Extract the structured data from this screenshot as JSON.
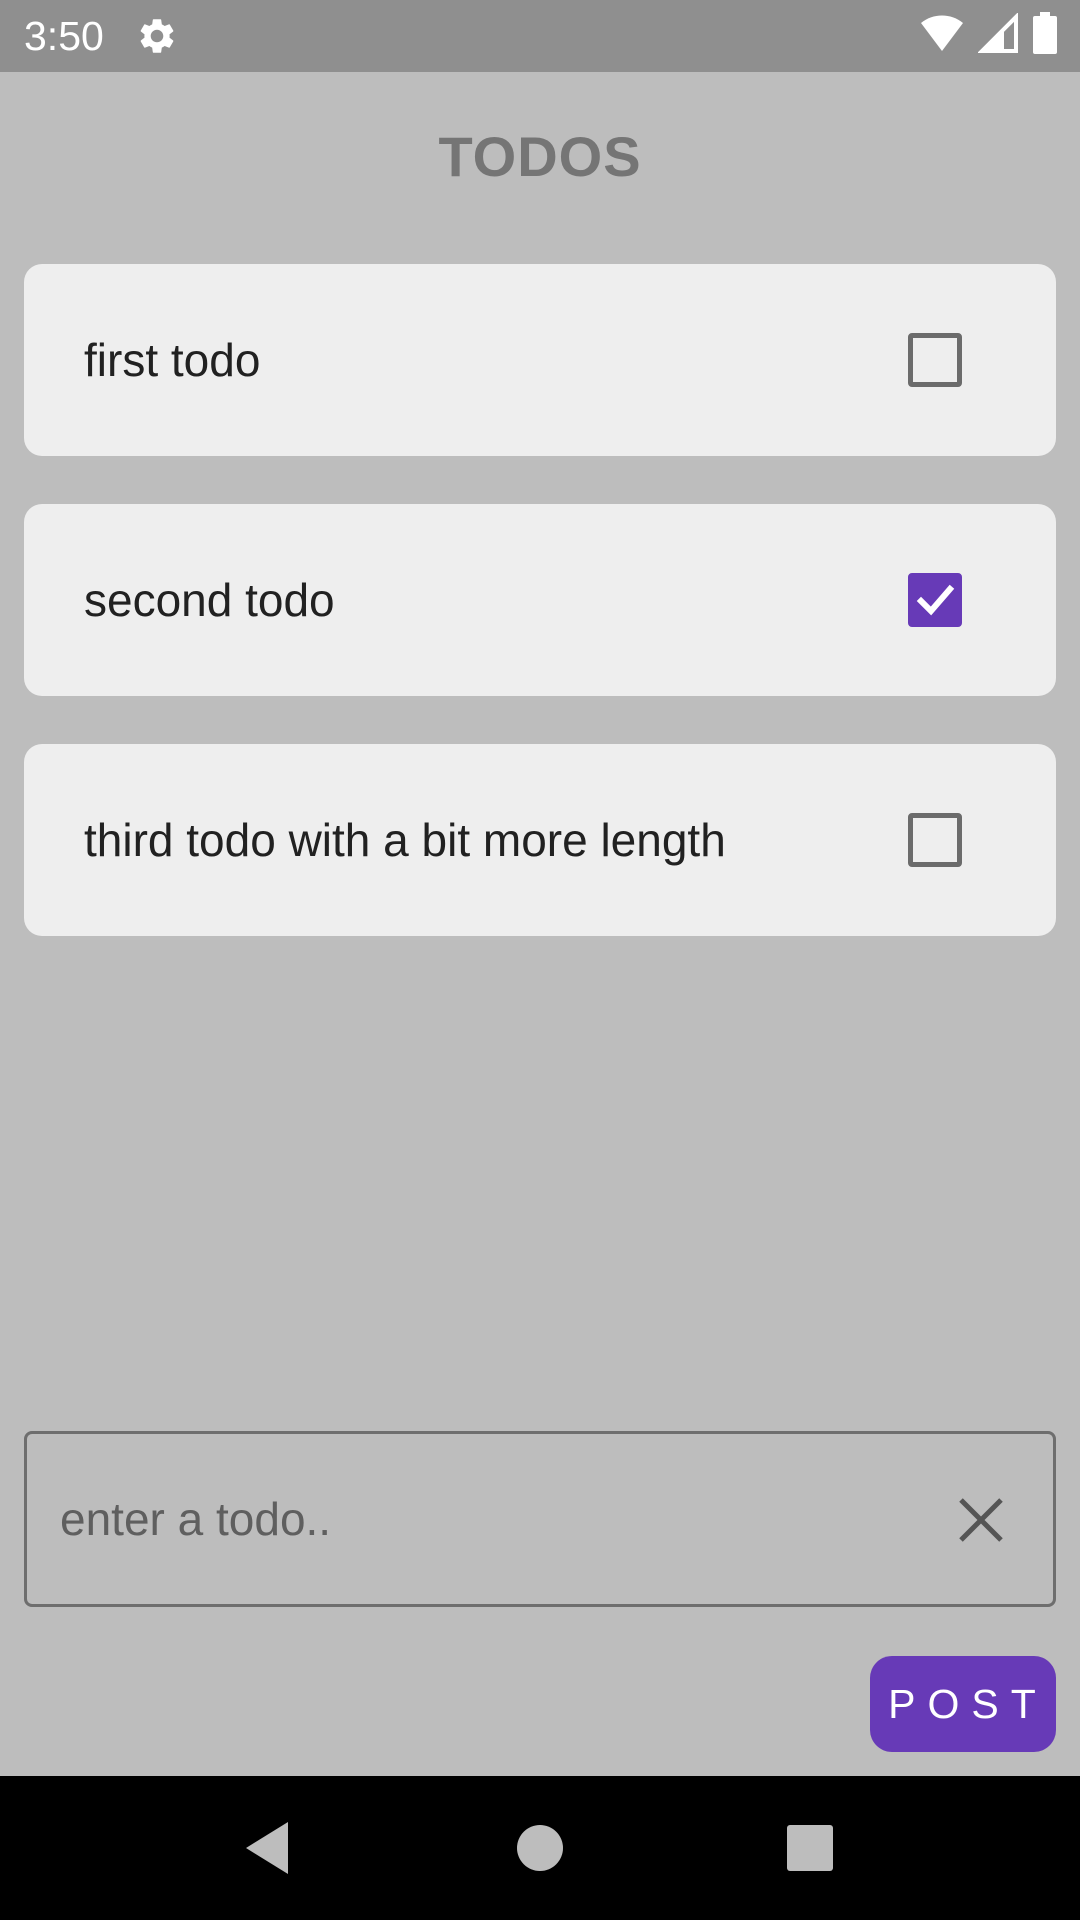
{
  "status_bar": {
    "time": "3:50",
    "icons": [
      "gear-icon",
      "wifi-icon",
      "signal-icon",
      "battery-icon"
    ]
  },
  "app": {
    "title": "TODOS"
  },
  "todos": [
    {
      "text": "first todo",
      "checked": false
    },
    {
      "text": "second todo",
      "checked": true
    },
    {
      "text": "third todo with a bit more length",
      "checked": false
    }
  ],
  "input": {
    "placeholder": "enter a todo..",
    "value": "",
    "clear_icon": "close-icon"
  },
  "post_button": {
    "label": "POST"
  },
  "nav_bar": {
    "icons": [
      "back-icon",
      "home-icon",
      "recents-icon"
    ]
  },
  "colors": {
    "accent": "#673ab7",
    "background": "#bdbdbd",
    "card": "#eeeeee",
    "status_bar": "#8f8f8f"
  }
}
